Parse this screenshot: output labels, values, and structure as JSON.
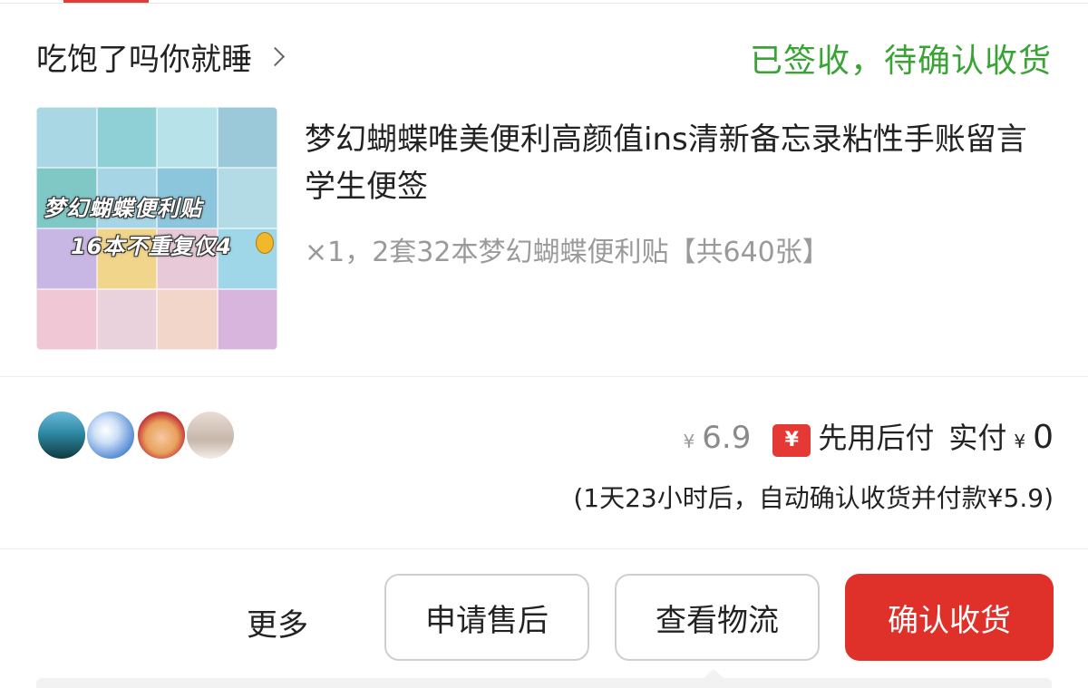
{
  "header": {
    "shop_name": "吃饱了吗你就睡",
    "order_status": "已签收，待确认收货"
  },
  "product": {
    "title": "梦幻蝴蝶唯美便利高颜值ins清新备忘录粘性手账留言学生便签",
    "spec": "×1，2套32本梦幻蝴蝶便利贴【共640张】",
    "thumbnail": {
      "line1": "梦幻蝴蝶便利贴",
      "line2": "16本不重复仅4"
    }
  },
  "avatars": {
    "count": 4,
    "items": [
      {
        "name": "lake-landscape-avatar",
        "color": "#2d7d8f"
      },
      {
        "name": "clouds-sky-avatar",
        "color": "#5b8fd6"
      },
      {
        "name": "sunglasses-face-avatar",
        "color": "#e0a35a"
      },
      {
        "name": "beach-person-avatar",
        "color": "#d9c8c0"
      }
    ]
  },
  "price": {
    "yen_symbol": "¥",
    "original": "6.9",
    "card_symbol": "¥",
    "pay_later": "先用后付",
    "paid_label": "实付",
    "paid_yen": "¥",
    "paid_amount": "0",
    "auto_confirm": "(1天23小时后，自动确认收货并付款¥5.9)"
  },
  "actions": {
    "more": "更多",
    "after_sale": "申请售后",
    "logistics": "查看物流",
    "confirm": "确认收货"
  },
  "colors": {
    "status_green": "#3aa335",
    "accent_red": "#e0302a"
  }
}
